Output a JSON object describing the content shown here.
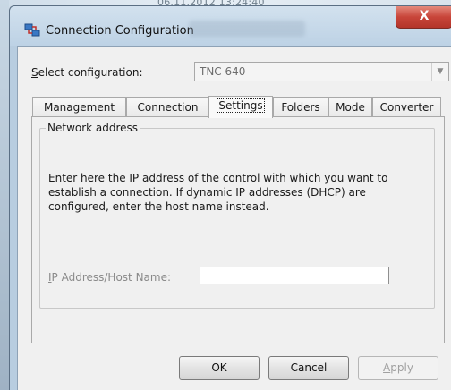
{
  "background": {
    "timestamp_text": "06.11.2012 13:24:40"
  },
  "window": {
    "title": "Connection Configuration",
    "close_label": "X",
    "accent_color": "#c8453a"
  },
  "config": {
    "label_hotkey": "S",
    "label_rest": "elect configuration:",
    "selected_value": "TNC 640"
  },
  "tabs": [
    {
      "label": "Management",
      "active": false
    },
    {
      "label": "Connection",
      "active": false
    },
    {
      "label": "Settings",
      "active": true
    },
    {
      "label": "Folders",
      "active": false
    },
    {
      "label": "Mode",
      "active": false
    },
    {
      "label": "Converter",
      "active": false
    }
  ],
  "settings": {
    "group_title": "Network address",
    "description": "Enter here the IP address of the control with which you want to establish a connection. If dynamic IP addresses (DHCP) are configured, enter the host name instead.",
    "ip_label_hotkey": "I",
    "ip_label_rest": "P Address/Host Name:",
    "ip_value": ""
  },
  "buttons": {
    "ok": "OK",
    "cancel": "Cancel",
    "apply_hotkey": "A",
    "apply_rest": "pply"
  },
  "icons": {
    "title_icon": "network-connection-icon",
    "dropdown_arrow": "chevron-down-icon"
  }
}
